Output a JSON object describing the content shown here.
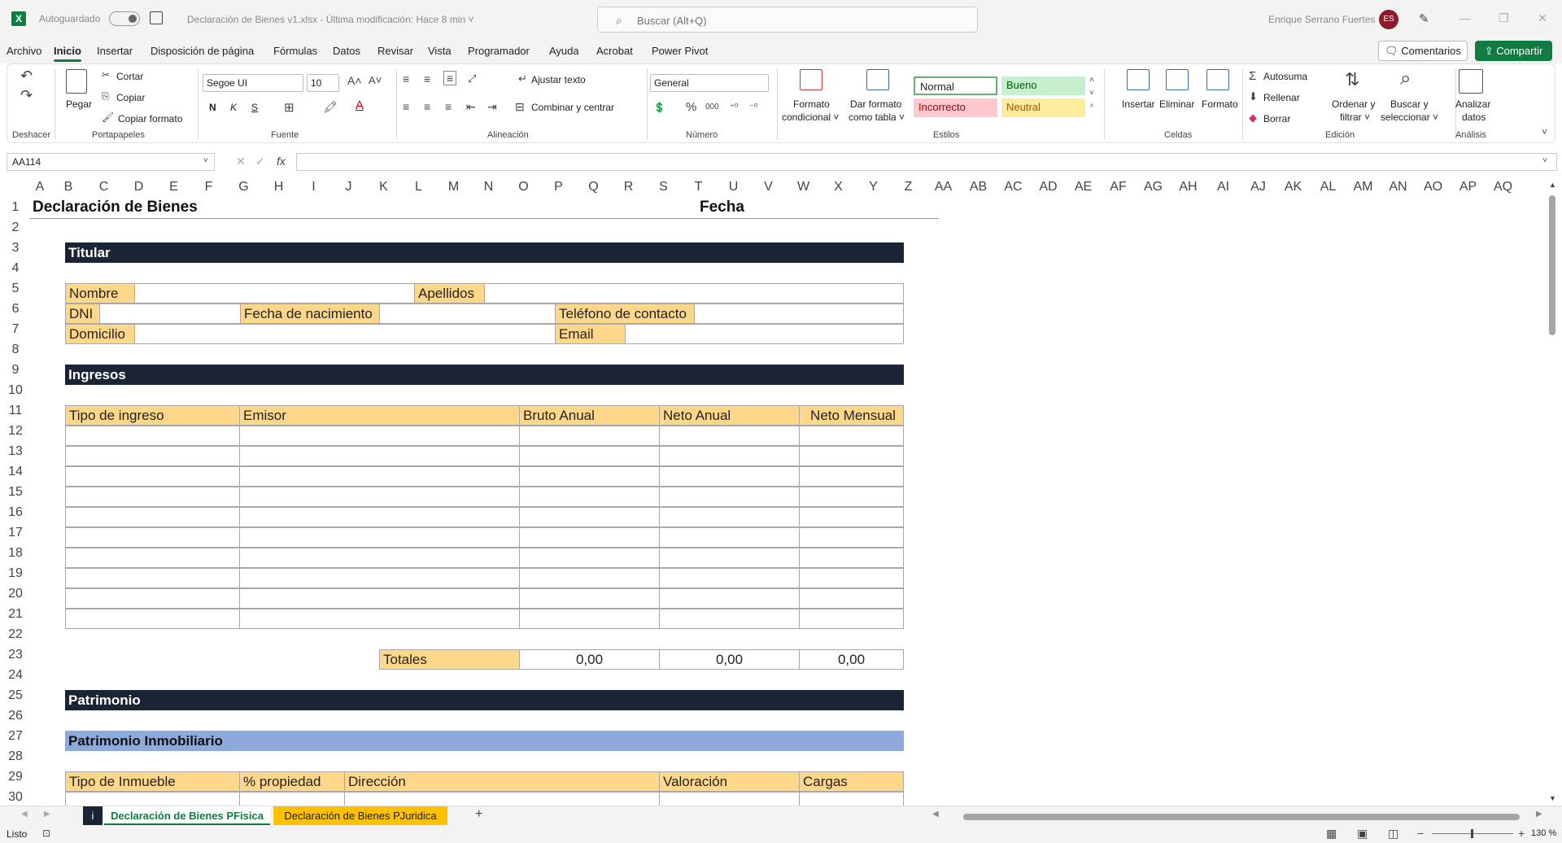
{
  "titlebar": {
    "app_logo": "X",
    "autosave_label": "Autoguardado",
    "doc_title": "Declaración de Bienes v1.xlsx  -  Última modificación: Hace 8 min  ˅",
    "search_placeholder": "Buscar (Alt+Q)",
    "user_name": "Enrique Serrano Fuertes",
    "avatar_initials": "ES"
  },
  "menu": {
    "items": [
      "Archivo",
      "Inicio",
      "Insertar",
      "Disposición de página",
      "Fórmulas",
      "Datos",
      "Revisar",
      "Vista",
      "Programador",
      "Ayuda",
      "Acrobat",
      "Power Pivot"
    ],
    "comments_label": "Comentarios",
    "share_label": "Compartir"
  },
  "ribbon": {
    "undo_label": "Deshacer",
    "paste_label": "Pegar",
    "cut_label": "Cortar",
    "copy_label": "Copiar",
    "copy_format_label": "Copiar formato",
    "clipboard_label": "Portapapeles",
    "font_name": "Segoe UI",
    "font_size": "10",
    "bold_label": "N",
    "italic_label": "K",
    "underline_label": "S",
    "font_label": "Fuente",
    "wrap_text_label": "Ajustar texto",
    "merge_center_label": "Combinar y centrar",
    "alignment_label": "Alineación",
    "number_format": "General",
    "number_label": "Número",
    "cond_format_label": [
      "Formato",
      "condicional ˅"
    ],
    "format_table_label": [
      "Dar formato",
      "como tabla ˅"
    ],
    "styles": [
      "Normal",
      "Bueno",
      "Incorrecto",
      "Neutral"
    ],
    "styles_label": "Estilos",
    "insert_label": "Insertar",
    "delete_label": "Eliminar",
    "format_label": "Formato",
    "cells_label": "Celdas",
    "autosum_label": "Autosuma",
    "fill_label": "Rellenar",
    "clear_label": "Borrar",
    "sort_filter_label": [
      "Ordenar y",
      "filtrar ˅"
    ],
    "find_select_label": [
      "Buscar y",
      "seleccionar ˅"
    ],
    "edit_label": "Edición",
    "analyze_label": [
      "Analizar",
      "datos"
    ],
    "analysis_label": "Análisis",
    "colors": {
      "accent": "#107c41",
      "good_bg": "#c6efce",
      "good_fg": "#006100",
      "bad_bg": "#ffc7ce",
      "bad_fg": "#9c0006",
      "neutral_bg": "#ffeb9c",
      "neutral_fg": "#9c5700"
    }
  },
  "formula_bar": {
    "name_box": "AA114",
    "fx_label": "fx",
    "formula": ""
  },
  "columns": [
    "A",
    "B",
    "C",
    "D",
    "E",
    "F",
    "G",
    "H",
    "I",
    "J",
    "K",
    "L",
    "M",
    "N",
    "O",
    "P",
    "Q",
    "R",
    "S",
    "T",
    "U",
    "V",
    "W",
    "X",
    "Y",
    "Z",
    "AA",
    "AB",
    "AC",
    "AD",
    "AE",
    "AF",
    "AG",
    "AH",
    "AI",
    "AJ",
    "AK",
    "AL",
    "AM",
    "AN",
    "AO",
    "AP",
    "AQ"
  ],
  "rows": [
    "1",
    "2",
    "3",
    "4",
    "5",
    "6",
    "7",
    "8",
    "9",
    "10",
    "11",
    "12",
    "13",
    "14",
    "15",
    "16",
    "17",
    "18",
    "19",
    "20",
    "21",
    "22",
    "23",
    "24",
    "25",
    "26",
    "27",
    "28",
    "29",
    "30"
  ],
  "sheet": {
    "title": "Declaración de Bienes",
    "date_label": "Fecha",
    "titular_header": "Titular",
    "nombre_label": "Nombre",
    "apellidos_label": "Apellidos",
    "dni_label": "DNI",
    "fecha_nac_label": "Fecha de nacimiento",
    "telefono_label": "Teléfono de contacto",
    "domicilio_label": "Domicilio",
    "email_label": "Email",
    "ingresos_header": "Ingresos",
    "ingresos_cols": [
      "Tipo de ingreso",
      "Emisor",
      "Bruto Anual",
      "Neto Anual",
      "Neto Mensual"
    ],
    "totales_label": "Totales",
    "totales_values": [
      "0,00",
      "0,00",
      "0,00"
    ],
    "patrimonio_header": "Patrimonio",
    "inmobiliario_header": "Patrimonio Inmobiliario",
    "inmueble_cols": [
      "Tipo de Inmueble",
      "% propiedad",
      "Dirección",
      "Valoración",
      "Cargas"
    ]
  },
  "tabs": {
    "info_tab": "i",
    "sheet1": "Declaración de Bienes PFisica",
    "sheet2": "Declaración de Bienes PJuridica",
    "add_label": "+"
  },
  "status": {
    "ready": "Listo",
    "zoom": "130 %"
  }
}
